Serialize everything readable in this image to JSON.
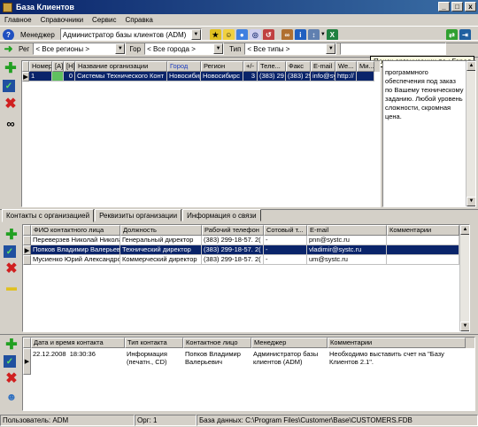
{
  "window": {
    "title": "База Клиентов",
    "min": "_",
    "max": "□",
    "close": "x"
  },
  "menu": [
    "Главное",
    "Справочники",
    "Сервис",
    "Справка"
  ],
  "toolbar": {
    "manager_label": "Менеджер",
    "manager_value": "Администратор базы клиентов (ADM)"
  },
  "filters": {
    "region_label": "Рег",
    "region_value": "< Все регионы >",
    "city_label": "Гор",
    "city_value": "< Все города >",
    "type_label": "Тип",
    "type_value": "< Все типы >"
  },
  "tooltip": "Поиск организации по : Город",
  "org_grid": {
    "headers": [
      "Номер",
      "[А]",
      "[Н]",
      "Название организации",
      "Город",
      "Регион",
      "+/-",
      "Теле...",
      "Факс",
      "E-mail",
      "We...",
      "Ми..."
    ],
    "rows": [
      [
        "1",
        "",
        "0",
        "Системы Технического Конт",
        "Новосибир",
        "Новосибирс",
        "3",
        "(383) 29",
        "(383) 29",
        "info@sy",
        "http://",
        ""
      ]
    ]
  },
  "memo": "программного обеспечения под заказ по Вашему техническому заданию. Любой уровень сложности, скромная цена.",
  "tabs": [
    "Контакты с организацией",
    "Реквизиты организации",
    "Информация о связи"
  ],
  "contacts_grid": {
    "headers": [
      "ФИО контактного лица",
      "Должность",
      "Рабочий телефон",
      "Сотовый т...",
      "E-mail",
      "Комментарии"
    ],
    "rows": [
      [
        "Переверзев Николай Николаевич",
        "Генеральный директор",
        "(383) 299-18-57. 2(",
        "-",
        "pnn@systc.ru",
        ""
      ],
      [
        "Попков Владимир Валерьевич",
        "Технический директор",
        "(383) 299-18-57. 2(",
        "-",
        "vladimir@systc.ru",
        ""
      ],
      [
        "Мусиенко Юрий Александрович",
        "Коммерческий директор",
        "(383) 299-18-57. 2(",
        "-",
        "um@systc.ru",
        ""
      ]
    ]
  },
  "history_grid": {
    "headers": [
      "Дата и время контакта",
      "Тип контакта",
      "Контактное лицо",
      "Менеджер",
      "Комментарии"
    ],
    "rows": [
      [
        "22.12.2008  18:30:36",
        "Информация (печатн., CD)",
        "Попков Владимир Валерьевич",
        "Администратор базы клиентов (ADM)",
        "Необходимо выставить счет на \"Базу Клиентов 2.1\"."
      ]
    ]
  },
  "status": {
    "user": "Пользователь: ADM",
    "org": "Орг: 1",
    "db": "База данных: C:\\Program Files\\Customer\\Base\\CUSTOMERS.FDB"
  },
  "colors": {
    "title_bar": "#0a246a",
    "selection": "#0a246a",
    "add": "#22a022",
    "delete": "#d02020"
  }
}
